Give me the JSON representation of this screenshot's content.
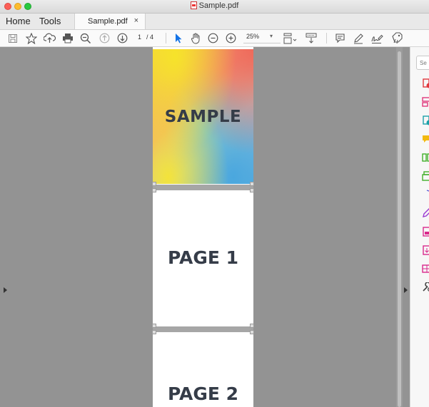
{
  "window": {
    "title": "Sample.pdf"
  },
  "nav": {
    "home": "Home",
    "tools": "Tools"
  },
  "doc_tab": {
    "label": "Sample.pdf",
    "close": "×"
  },
  "toolbar": {
    "page_current": "1",
    "page_total": "/ 4",
    "zoom": "25%",
    "zoom_caret": "▾"
  },
  "pages": [
    {
      "label": "SAMPLE"
    },
    {
      "label": "PAGE 1"
    },
    {
      "label": "PAGE 2"
    }
  ],
  "right_panel": {
    "search_placeholder": "Se",
    "icons": [
      {
        "name": "create-pdf-icon",
        "color": "#e0383e"
      },
      {
        "name": "edit-pdf-icon",
        "color": "#e0387a"
      },
      {
        "name": "export-pdf-icon",
        "color": "#1aa0a8"
      },
      {
        "name": "comment-icon",
        "color": "#f2b90f"
      },
      {
        "name": "combine-files-icon",
        "color": "#43b02a"
      },
      {
        "name": "organize-pages-icon",
        "color": "#43b02a"
      },
      {
        "name": "protect-icon",
        "color": "#5a5fd8"
      },
      {
        "name": "fill-sign-icon",
        "color": "#9b3ad1"
      },
      {
        "name": "send-for-signature-icon",
        "color": "#d9298c"
      },
      {
        "name": "send-file-icon",
        "color": "#d9298c"
      },
      {
        "name": "rich-media-icon",
        "color": "#d9298c"
      },
      {
        "name": "more-tools-icon",
        "color": "#444444"
      }
    ]
  }
}
